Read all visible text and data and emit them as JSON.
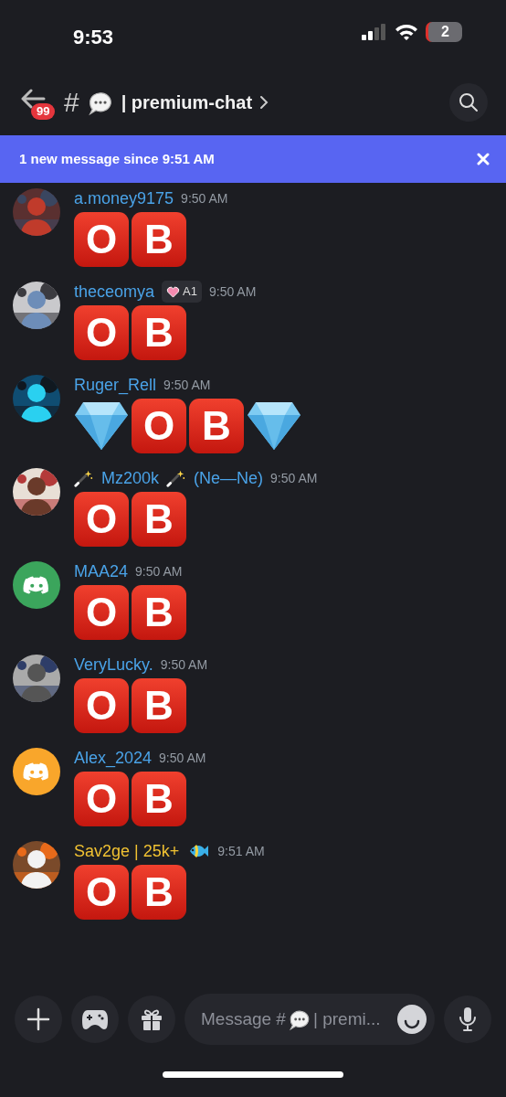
{
  "status_bar": {
    "time": "9:53",
    "battery": "2"
  },
  "header": {
    "unread_badge": "99",
    "hash": "#",
    "channel_name": "| premium-chat"
  },
  "banner": {
    "text": "1 new message since 9:51 AM"
  },
  "messages": [
    {
      "avatar": {
        "kind": "picture"
      },
      "color": "#4aa3e8",
      "name_parts": [
        {
          "kind": "text",
          "text": "a.money9175"
        }
      ],
      "time": "9:50 AM",
      "content": [
        {
          "kind": "letter",
          "text": "O"
        },
        {
          "kind": "letter",
          "text": "B"
        }
      ]
    },
    {
      "avatar": {
        "kind": "picture"
      },
      "color": "#4aa3e8",
      "name_parts": [
        {
          "kind": "text",
          "text": "theceomya"
        }
      ],
      "tag": "A1",
      "time": "9:50 AM",
      "content": [
        {
          "kind": "letter",
          "text": "O"
        },
        {
          "kind": "letter",
          "text": "B"
        }
      ]
    },
    {
      "avatar": {
        "kind": "picture"
      },
      "color": "#4aa3e8",
      "name_parts": [
        {
          "kind": "text",
          "text": "Ruger_Rell"
        }
      ],
      "time": "9:50 AM",
      "content": [
        {
          "kind": "diamond"
        },
        {
          "kind": "letter",
          "text": "O"
        },
        {
          "kind": "letter",
          "text": "B"
        },
        {
          "kind": "diamond"
        }
      ]
    },
    {
      "avatar": {
        "kind": "picture"
      },
      "color": "#4aa3e8",
      "name_parts": [
        {
          "kind": "wand"
        },
        {
          "kind": "text",
          "text": "Mz200k"
        },
        {
          "kind": "wand"
        },
        {
          "kind": "text",
          "text": "(Ne—Ne)"
        }
      ],
      "time": "9:50 AM",
      "content": [
        {
          "kind": "letter",
          "text": "O"
        },
        {
          "kind": "letter",
          "text": "B"
        }
      ]
    },
    {
      "avatar": {
        "kind": "default",
        "color": "#3ba55c"
      },
      "color": "#4aa3e8",
      "name_parts": [
        {
          "kind": "text",
          "text": "MAA24"
        }
      ],
      "time": "9:50 AM",
      "content": [
        {
          "kind": "letter",
          "text": "O"
        },
        {
          "kind": "letter",
          "text": "B"
        }
      ]
    },
    {
      "avatar": {
        "kind": "picture"
      },
      "color": "#4aa3e8",
      "name_parts": [
        {
          "kind": "text",
          "text": "VeryLucky."
        }
      ],
      "time": "9:50 AM",
      "content": [
        {
          "kind": "letter",
          "text": "O"
        },
        {
          "kind": "letter",
          "text": "B"
        }
      ]
    },
    {
      "avatar": {
        "kind": "default",
        "color": "#f9a62b"
      },
      "color": "#4aa3e8",
      "name_parts": [
        {
          "kind": "text",
          "text": "Alex_2024"
        }
      ],
      "time": "9:50 AM",
      "content": [
        {
          "kind": "letter",
          "text": "O"
        },
        {
          "kind": "letter",
          "text": "B"
        }
      ]
    },
    {
      "avatar": {
        "kind": "picture"
      },
      "color": "#f1c232",
      "name_parts": [
        {
          "kind": "text",
          "text": "Sav2ge | 25k+"
        },
        {
          "kind": "fish"
        }
      ],
      "time": "9:51 AM",
      "content": [
        {
          "kind": "letter",
          "text": "O"
        },
        {
          "kind": "letter",
          "text": "B"
        }
      ]
    }
  ],
  "composer": {
    "placeholder_parts": [
      {
        "kind": "text",
        "text": "Message #"
      },
      {
        "kind": "bubble"
      },
      {
        "kind": "text",
        "text": "| premi..."
      }
    ]
  }
}
